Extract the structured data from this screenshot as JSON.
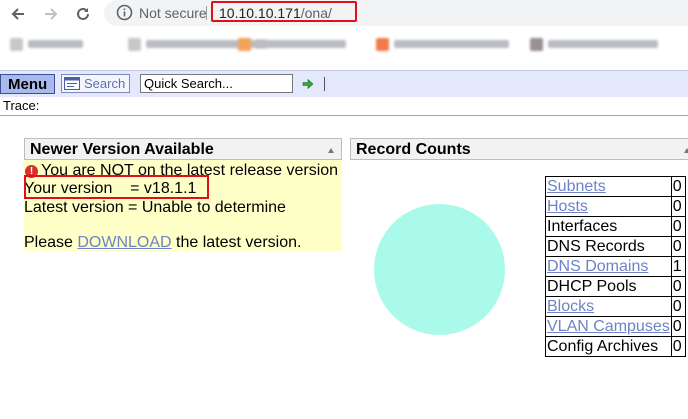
{
  "browser": {
    "security_label": "Not secure",
    "url_host": "10.10.10.171",
    "url_path": "/ona/",
    "bookmarks": [
      {
        "favicon_color": "#c8c8c8",
        "text_width": 55
      },
      {
        "favicon_color": "#c8c8c8",
        "text_width": 120
      },
      {
        "favicon_color": "#f5a25a",
        "text_width": 90
      },
      {
        "favicon_color": "#f07a4b",
        "text_width": 115
      },
      {
        "favicon_color": "#9a8f91",
        "text_width": 110
      }
    ]
  },
  "menubar": {
    "menu_label": "Menu",
    "search_label": "Search",
    "quick_search_placeholder": "Quick Search..."
  },
  "trace": {
    "label": "Trace:"
  },
  "version_panel": {
    "title": "Newer Version Available",
    "warning": "You are NOT on the latest release version",
    "your_version": "Your version    = v18.1.1",
    "latest_version": "Latest version = Unable to determine",
    "download_prefix": "Please ",
    "download_link": "DOWNLOAD",
    "download_suffix": " the latest version."
  },
  "record_panel": {
    "title": "Record Counts",
    "pie_color": "#aafaeb",
    "rows": [
      {
        "name": "Subnets",
        "count": "0",
        "link": true
      },
      {
        "name": "Hosts",
        "count": "0",
        "link": true
      },
      {
        "name": "Interfaces",
        "count": "0",
        "link": false
      },
      {
        "name": "DNS Records",
        "count": "0",
        "link": false
      },
      {
        "name": "DNS Domains",
        "count": "1",
        "link": true
      },
      {
        "name": "DHCP Pools",
        "count": "0",
        "link": false
      },
      {
        "name": "Blocks",
        "count": "0",
        "link": true
      },
      {
        "name": "VLAN Campuses",
        "count": "0",
        "link": true
      },
      {
        "name": "Config Archives",
        "count": "0",
        "link": false
      }
    ]
  },
  "colors": {
    "highlight": "#e0101b",
    "link": "#6e82c8",
    "notice_bg": "#ffffc8"
  }
}
